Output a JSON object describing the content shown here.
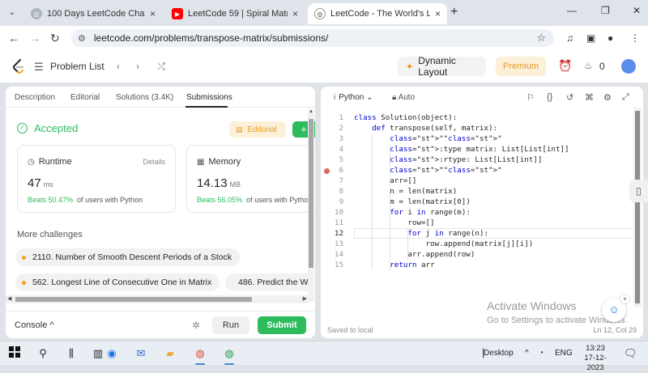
{
  "browser": {
    "tabs": [
      {
        "title": "100 Days LeetCode Challenge -",
        "close": "×"
      },
      {
        "title": "LeetCode 59 | Spiral Matrix II | L",
        "close": "×"
      },
      {
        "title": "LeetCode - The World's Leading",
        "close": "×"
      }
    ],
    "new_tab": "+",
    "tab_list": "⌄",
    "window_controls": {
      "minimize": "—",
      "maximize": "❐",
      "close": "✕"
    },
    "url": "leetcode.com/problems/transpose-matrix/submissions/"
  },
  "header": {
    "problem_list": "Problem List",
    "dynamic_layout": "Dynamic Layout",
    "premium": "Premium",
    "streak_count": "0"
  },
  "left_panel": {
    "tabs": [
      "Description",
      "Editorial",
      "Solutions (3.4K)",
      "Submissions"
    ],
    "status": "Accepted",
    "editorial_button": "Editorial",
    "runtime": {
      "label": "Runtime",
      "details": "Details",
      "value": "47",
      "unit": "ms",
      "beats": "Beats 50.47%",
      "beats_suffix": "of users with Python"
    },
    "memory": {
      "label": "Memory",
      "value": "14.13",
      "unit": "MB",
      "beats": "Beats 56.05%",
      "beats_suffix": "of users with Python"
    },
    "more_challenges": "More challenges",
    "challenges": [
      "2110. Number of Smooth Descent Periods of a Stock",
      "562. Longest Line of Consecutive One in Matrix",
      "486. Predict the W"
    ]
  },
  "bottom_bar": {
    "console": "Console",
    "run": "Run",
    "submit": "Submit"
  },
  "editor": {
    "language": "Python",
    "mode": "Auto",
    "saved_status": "Saved to local",
    "cursor_position": "Ln 12, Col 29",
    "lines": [
      "class Solution(object):",
      "    def transpose(self, matrix):",
      "        \"\"\"",
      "        :type matrix: List[List[int]]",
      "        :rtype: List[List[int]]",
      "        \"\"\"",
      "        arr=[]",
      "        n = len(matrix)",
      "        m = len(matrix[0])",
      "        for i in range(m):",
      "            row=[]",
      "            for j in range(n):",
      "                row.append(matrix[j][i])",
      "            arr.append(row)",
      "        return arr"
    ],
    "line_numbers": [
      "1",
      "2",
      "3",
      "4",
      "5",
      "6",
      "7",
      "8",
      "9",
      "10",
      "11",
      "12",
      "13",
      "14",
      "15"
    ]
  },
  "overlay": {
    "activate_title": "Activate Windows",
    "activate_sub": "Go to Settings to activate Windows."
  },
  "taskbar": {
    "desktop": "Desktop",
    "language": "ENG",
    "time": "13:23",
    "date": "17-12-2023"
  },
  "colors": {
    "accent_green": "#2cbb5d",
    "premium_orange": "#e89a1d",
    "keyword_blue": "#0000cc"
  }
}
